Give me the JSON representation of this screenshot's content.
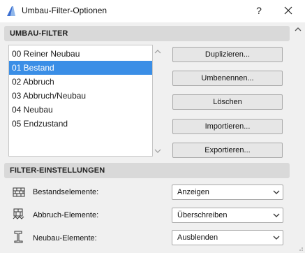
{
  "window": {
    "title": "Umbau-Filter-Optionen",
    "help_label": "?",
    "icons": {
      "app": "archicad-app-icon",
      "close": "close-icon"
    }
  },
  "filter_section": {
    "header": "UMBAU-FILTER",
    "items": [
      {
        "label": "00 Reiner Neubau",
        "selected": false
      },
      {
        "label": "01 Bestand",
        "selected": true
      },
      {
        "label": "02 Abbruch",
        "selected": false
      },
      {
        "label": "03 Abbruch/Neubau",
        "selected": false
      },
      {
        "label": "04 Neubau",
        "selected": false
      },
      {
        "label": "05 Endzustand",
        "selected": false
      }
    ],
    "buttons": {
      "duplicate": "Duplizieren...",
      "rename": "Umbenennen...",
      "delete": "Löschen",
      "import": "Importieren...",
      "export": "Exportieren..."
    }
  },
  "settings_section": {
    "header": "FILTER-EINSTELLUNGEN",
    "rows": [
      {
        "label": "Bestandselemente:",
        "value": "Anzeigen",
        "icon": "existing-elements-icon"
      },
      {
        "label": "Abbruch-Elemente:",
        "value": "Überschreiben",
        "icon": "demolished-elements-icon"
      },
      {
        "label": "Neubau-Elemente:",
        "value": "Ausblenden",
        "icon": "new-elements-icon"
      }
    ]
  },
  "colors": {
    "selection": "#3a8ee6",
    "dialog_bg": "#f0f0f0",
    "header_bg": "#d9d9d9",
    "button_bg": "#e6e6e6"
  }
}
